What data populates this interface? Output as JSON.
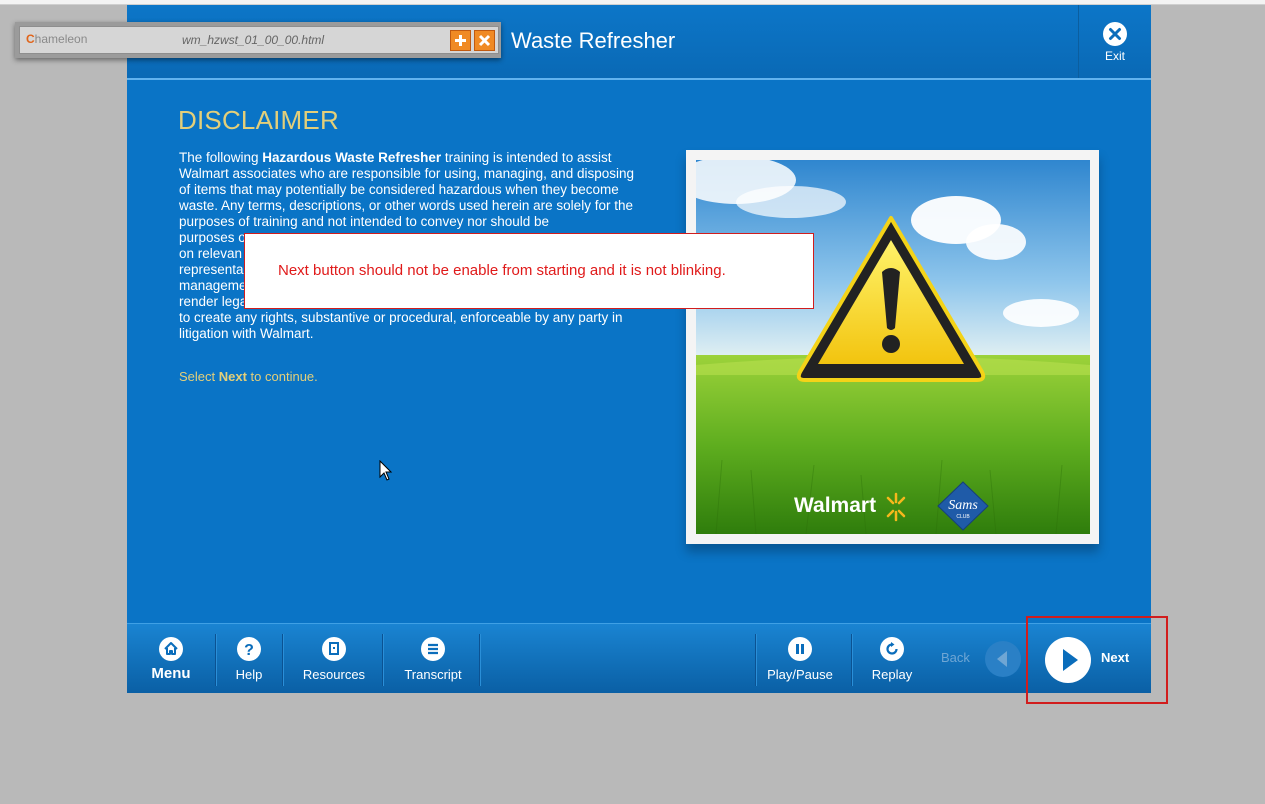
{
  "window": {
    "title": "Waste Refresher",
    "exit_label": "Exit"
  },
  "chameleon": {
    "logo_text": "hameleon",
    "file_name": "wm_hzwst_01_00_00.html"
  },
  "content": {
    "heading": "DISCLAIMER",
    "para_intro": "The following ",
    "para_bold": "Hazardous Waste Refresher",
    "para_rest": " training is intended to assist Walmart associates who are responsible for using, managing, and disposing of items that may potentially be considered hazardous when they become waste.  Any terms, descriptions, or other words used herein are solely for the purposes of training and not intended to convey nor should be",
    "line_purposes": "purposes o",
    "line_relevant": "on relevan",
    "line_representa": "representa",
    "line_manageme": "manageme",
    "para_end": "render legal advice.  This training is not intended and cannot be relied upon to create any rights, substantive or procedural, enforceable by any party in litigation with Walmart.",
    "continue_prefix": "Select ",
    "continue_bold": "Next",
    "continue_suffix": " to continue."
  },
  "image": {
    "brand_walmart": "Walmart",
    "brand_sams": "Sams",
    "brand_sams_sub": "CLUB"
  },
  "toolbar": {
    "menu": "Menu",
    "help": "Help",
    "resources": "Resources",
    "transcript": "Transcript",
    "play_pause": "Play/Pause",
    "replay": "Replay",
    "back": "Back",
    "next": "Next"
  },
  "annotation": {
    "note": "Next button should not be enable from starting and it is not blinking."
  },
  "colors": {
    "course_blue": "#0a74c6",
    "heading_gold": "#e3cf7a",
    "annotation_red": "#d11d1d",
    "accent_orange": "#f08a24"
  }
}
